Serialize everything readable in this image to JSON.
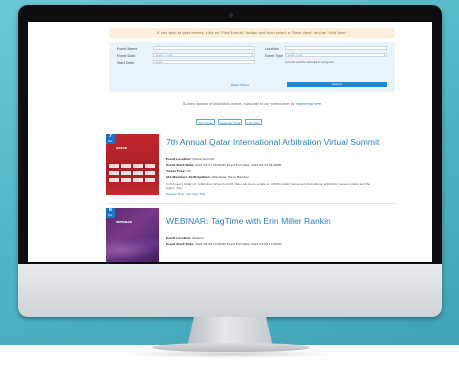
{
  "notice": "If you wish to post events, click on \"Find Events\" button and then select a \"Save View\" and an \"Add New\"",
  "filters": {
    "left": [
      {
        "label": "Event Name",
        "value": "",
        "placeholder": ""
      },
      {
        "label": "Event Date",
        "value": "Select a date",
        "placeholder": ""
      },
      {
        "label": "Start Date",
        "value": "Select",
        "placeholder": ""
      }
    ],
    "right": [
      {
        "label": "Location",
        "value": "",
        "placeholder": ""
      },
      {
        "label": "Event Type",
        "value": "Select type",
        "placeholder": ""
      }
    ],
    "checkbox_text": "Include events allowed to program",
    "reset_label": "Reset filters",
    "search_label": "Search"
  },
  "keep_text": {
    "prefix": "To keep abreast of Arbitration events, subscribe to our events alert by",
    "link": "registering here"
  },
  "view_buttons": [
    "Grid View",
    "Calendar View",
    "List View"
  ],
  "events": [
    {
      "badge_day": "7",
      "badge_month": "Mar",
      "thumb_title": "QATAR",
      "title": "7th Annual Qatar International Arbitration Virtual Summit",
      "meta": [
        {
          "label": "Event Location:",
          "value": "Virtual Summit"
        },
        {
          "label": "Event Start Date:",
          "value": "2021-03-07 08:00AM   Event End Date: 2021-03-10 04:00PM"
        },
        {
          "label": "Ticket Fees:",
          "value": "QR"
        },
        {
          "label": "IAA Members Participation:",
          "value": "Attendees, Panel Member"
        }
      ],
      "description": "In this year's Qatar Int. Arbitration Virtual Summit, there will be an update on COVID related issues and international arbitration issues in Qatar and the region. The...",
      "register_label": "Register Now",
      "see_label": "See more Text"
    },
    {
      "badge_day": "8",
      "badge_month": "Mar",
      "thumb_title": "WEBINAR",
      "title": "WEBINAR: TagTime with Erin Miller Rankin",
      "meta": [
        {
          "label": "Event Location:",
          "value": "Webinar"
        },
        {
          "label": "Event Start Date:",
          "value": "2021-03-08 10:00AM   Event End Date: 2021-03-08 11:00AM"
        }
      ]
    }
  ]
}
